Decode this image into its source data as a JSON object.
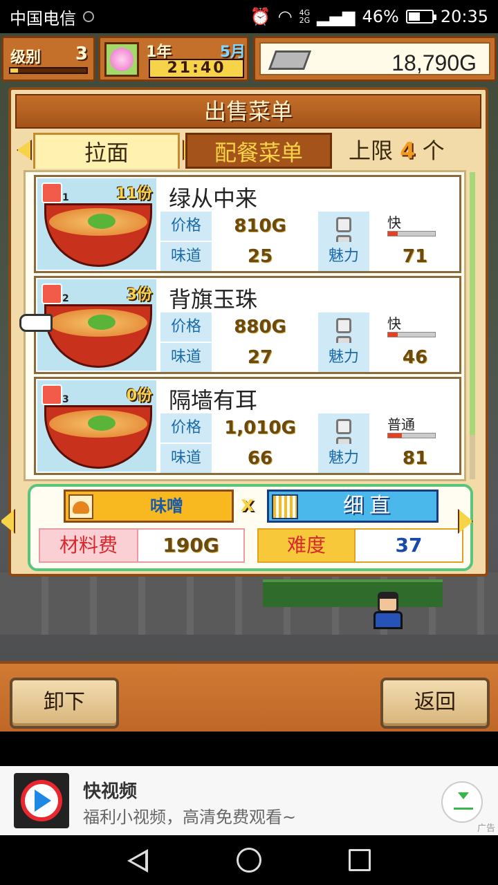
{
  "status_bar": {
    "carrier": "中国电信",
    "network": [
      "4G",
      "2G"
    ],
    "battery": "46%",
    "time": "20:35"
  },
  "hud": {
    "level_label": "级别",
    "level_value": "3",
    "level_progress": 0.1,
    "year": "1年",
    "month": "5月",
    "clock": "21:40",
    "money": "18,790G"
  },
  "panel": {
    "title": "出售菜单",
    "tabs": [
      {
        "label": "拉面"
      },
      {
        "label": "配餐菜单"
      }
    ],
    "limit_label": "上限",
    "limit_value": "4",
    "limit_unit": "个"
  },
  "menu_items": [
    {
      "badge_num": "1",
      "count": "11份",
      "name": "绿从中来",
      "price_label": "价格",
      "price": "810G",
      "taste_label": "味道",
      "taste": "25",
      "charm_label": "魅力",
      "charm": "71",
      "speed": "快",
      "speed_level": 0.2
    },
    {
      "badge_num": "2",
      "count": "3份",
      "name": "背旗玉珠",
      "price_label": "价格",
      "price": "880G",
      "taste_label": "味道",
      "taste": "27",
      "charm_label": "魅力",
      "charm": "46",
      "speed": "快",
      "speed_level": 0.2
    },
    {
      "badge_num": "3",
      "count": "0份",
      "name": "隔墙有耳",
      "price_label": "价格",
      "price": "1,010G",
      "taste_label": "味道",
      "taste": "66",
      "charm_label": "魅力",
      "charm": "81",
      "speed": "普通",
      "speed_level": 0.3
    }
  ],
  "recipe": {
    "soup": "味噌",
    "times": "x",
    "noodle": "细直",
    "cost_label": "材料费",
    "cost_value": "190G",
    "difficulty_label": "难度",
    "difficulty_value": "37"
  },
  "buttons": {
    "unload": "卸下",
    "back": "返回"
  },
  "ad": {
    "title": "快视频",
    "subtitle": "福利小视频，高清免费观看~",
    "tag": "广告"
  },
  "colors": {
    "panel_bg": "#f2dba8",
    "accent_wood": "#c46f2a",
    "label_blue": "#cfe9f7",
    "recipe_border": "#5ac47a"
  }
}
